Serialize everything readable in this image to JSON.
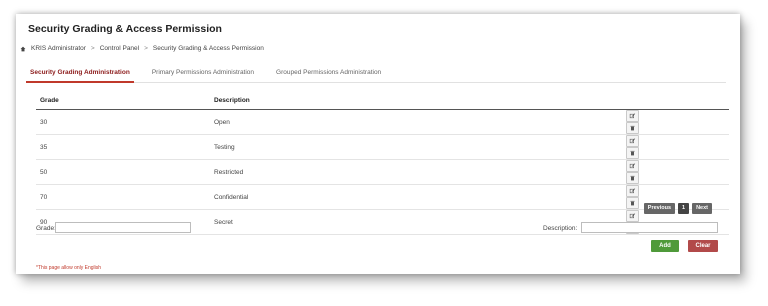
{
  "page_title": "Security Grading & Access Permission",
  "breadcrumb": [
    "KRIS Administrator",
    "Control Panel",
    "Security Grading & Access Permission"
  ],
  "breadcrumb_separator": ">",
  "tabs": [
    {
      "label": "Security Grading Administration",
      "active": true
    },
    {
      "label": "Primary Permissions Administration",
      "active": false
    },
    {
      "label": "Grouped Permissions Administration",
      "active": false
    }
  ],
  "table": {
    "headers": {
      "grade": "Grade",
      "description": "Description"
    },
    "rows": [
      {
        "grade": "30",
        "description": "Open"
      },
      {
        "grade": "35",
        "description": "Testing"
      },
      {
        "grade": "50",
        "description": "Restricted"
      },
      {
        "grade": "70",
        "description": "Confidential"
      },
      {
        "grade": "90",
        "description": "Secret"
      }
    ]
  },
  "pagination": {
    "previous": "Previous",
    "page": "1",
    "next": "Next"
  },
  "form": {
    "grade_label": "Grade:",
    "grade_value": "",
    "description_label": "Description:",
    "description_value": "",
    "add_label": "Add",
    "clear_label": "Clear"
  },
  "note": "*This page allow only English",
  "colors": {
    "accent": "#c0392b",
    "add": "#4f9a3a",
    "clear": "#b24a4a",
    "pager": "#666666"
  },
  "icons": {
    "home": "home-icon",
    "edit": "edit-icon",
    "delete": "trash-icon"
  }
}
